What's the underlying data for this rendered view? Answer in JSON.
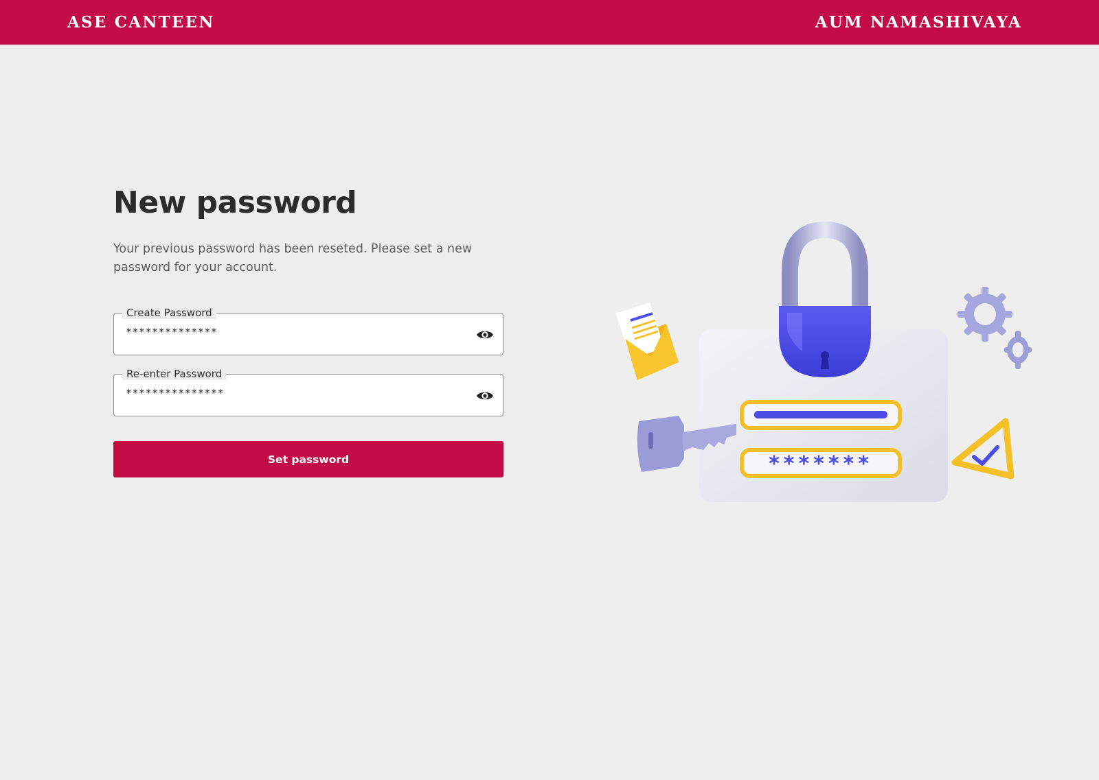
{
  "header": {
    "left_title": "ASE CANTEEN",
    "right_title": "AUM NAMASHIVAYA"
  },
  "main": {
    "title": "New password",
    "subtitle": "Your previous password has been reseted. Please set a new password for your account.",
    "fields": [
      {
        "label": "Create Password",
        "value": "**************",
        "icon": "eye-icon"
      },
      {
        "label": "Re-enter Password",
        "value": "***************",
        "icon": "eye-icon"
      }
    ],
    "submit_label": "Set password"
  },
  "illustration": {
    "masked_text": "*******",
    "colors": {
      "accent": "#c10c45",
      "indigo": "#4c4ce6",
      "yellow": "#f4c027",
      "lavender": "#9b9bd8"
    }
  }
}
